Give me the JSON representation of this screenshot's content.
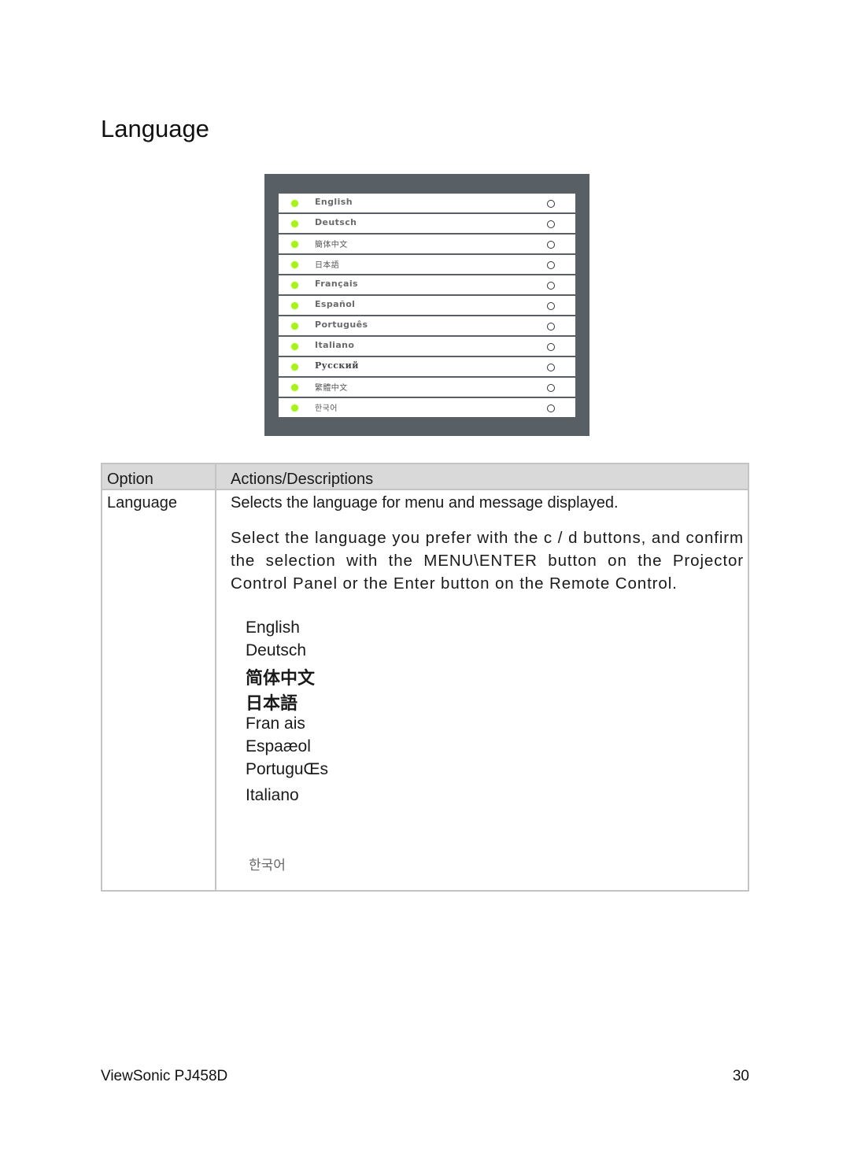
{
  "page": {
    "title": "Language"
  },
  "osd_menu": {
    "accent_color": "#a8f020",
    "background_color": "#586065",
    "items": [
      {
        "label": "English",
        "style": "latin"
      },
      {
        "label": "Deutsch",
        "style": "latin"
      },
      {
        "label": "簡体中文",
        "style": "cjk"
      },
      {
        "label": "日本語",
        "style": "cjk"
      },
      {
        "label": "Français",
        "style": "latin"
      },
      {
        "label": "Español",
        "style": "latin"
      },
      {
        "label": "Português",
        "style": "latin"
      },
      {
        "label": "Italiano",
        "style": "latin"
      },
      {
        "label": "Русский",
        "style": "serif"
      },
      {
        "label": "繁體中文",
        "style": "cjk"
      },
      {
        "label": "한국어",
        "style": "cjk"
      }
    ]
  },
  "table": {
    "headers": {
      "option": "Option",
      "actions": "Actions/Descriptions"
    },
    "row": {
      "option": "Language",
      "summary": "Selects the language for menu and message displayed.",
      "description": "Select the language you prefer with the c / d buttons, and confirm the selection with the MENU\\ENTER button on the Projector Control Panel or the Enter button on the Remote Control.",
      "languages": [
        "English",
        "Deutsch",
        "简体中文",
        "日本語",
        "Fran ais",
        "Espaæol",
        "PortuguŒs",
        "Italiano",
        "",
        "한국어"
      ]
    }
  },
  "footer": {
    "product": "ViewSonic PJ458D",
    "page_number": "30"
  }
}
